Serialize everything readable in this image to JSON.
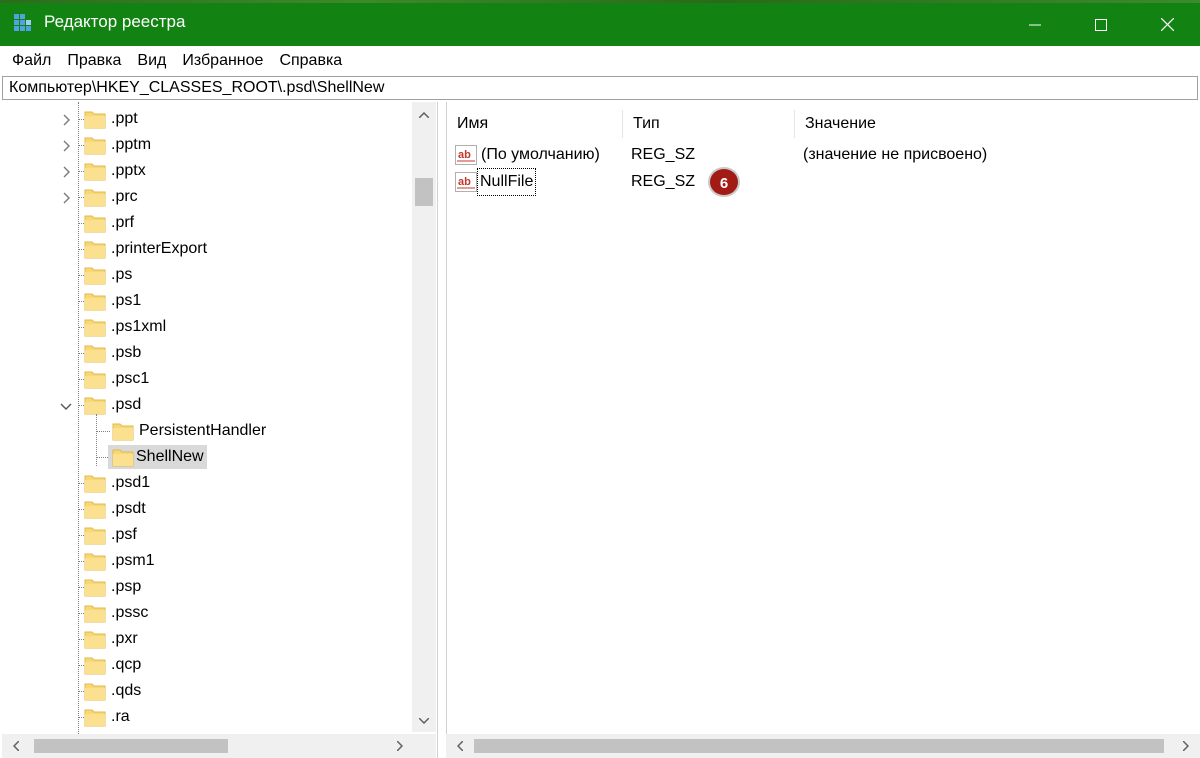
{
  "window": {
    "title": "Редактор реестра",
    "accent_color": "#128312",
    "app_icon": "registry-editor-icon",
    "controls": [
      "minimize-icon",
      "maximize-icon",
      "close-icon"
    ]
  },
  "menu": {
    "items": [
      "Файл",
      "Правка",
      "Вид",
      "Избранное",
      "Справка"
    ]
  },
  "address": {
    "path": "Компьютер\\HKEY_CLASSES_ROOT\\.psd\\ShellNew"
  },
  "tree": {
    "items": [
      {
        "label": ".ppt",
        "expandable": true
      },
      {
        "label": ".pptm",
        "expandable": true
      },
      {
        "label": ".pptx",
        "expandable": true
      },
      {
        "label": ".prc",
        "expandable": true
      },
      {
        "label": ".prf",
        "expandable": false
      },
      {
        "label": ".printerExport",
        "expandable": false
      },
      {
        "label": ".ps",
        "expandable": false
      },
      {
        "label": ".ps1",
        "expandable": false
      },
      {
        "label": ".ps1xml",
        "expandable": false
      },
      {
        "label": ".psb",
        "expandable": false
      },
      {
        "label": ".psc1",
        "expandable": false
      },
      {
        "label": ".psd",
        "expandable": true,
        "expanded": true
      },
      {
        "label": "PersistentHandler",
        "child": true
      },
      {
        "label": "ShellNew",
        "child": true,
        "selected": true
      },
      {
        "label": ".psd1",
        "expandable": false
      },
      {
        "label": ".psdt",
        "expandable": false
      },
      {
        "label": ".psf",
        "expandable": false
      },
      {
        "label": ".psm1",
        "expandable": false
      },
      {
        "label": ".psp",
        "expandable": false
      },
      {
        "label": ".pssc",
        "expandable": false
      },
      {
        "label": ".pxr",
        "expandable": false
      },
      {
        "label": ".qcp",
        "expandable": false
      },
      {
        "label": ".qds",
        "expandable": false
      },
      {
        "label": ".ra",
        "expandable": false
      }
    ]
  },
  "list": {
    "columns": [
      "Имя",
      "Тип",
      "Значение"
    ],
    "rows": [
      {
        "name": "(По умолчанию)",
        "type": "REG_SZ",
        "value": "(значение не присвоено)",
        "icon": "string-value-icon"
      },
      {
        "name": "NullFile",
        "type": "REG_SZ",
        "value": "",
        "icon": "string-value-icon",
        "focused": true
      }
    ]
  },
  "annotation": {
    "badge": "6",
    "badge_color": "#a31b15"
  }
}
